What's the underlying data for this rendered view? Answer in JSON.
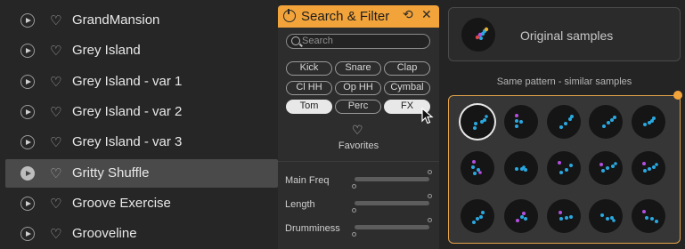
{
  "list": {
    "items": [
      {
        "name": "GrandMansion"
      },
      {
        "name": "Grey Island"
      },
      {
        "name": "Grey Island - var 1"
      },
      {
        "name": "Grey Island - var 2"
      },
      {
        "name": "Grey Island - var 3"
      },
      {
        "name": "Gritty Shuffle",
        "selected": true
      },
      {
        "name": "Groove Exercise"
      },
      {
        "name": "Grooveline"
      }
    ]
  },
  "panel": {
    "title": "Search & Filter",
    "search_placeholder": "Search",
    "tags": [
      "Kick",
      "Snare",
      "Clap",
      "Cl HH",
      "Op HH",
      "Cymbal",
      "Tom",
      "Perc",
      "FX"
    ],
    "active_tags": [
      "Tom",
      "FX"
    ],
    "favorites_label": "Favorites",
    "sliders": [
      {
        "label": "Main Freq"
      },
      {
        "label": "Length"
      },
      {
        "label": "Drumminess"
      }
    ],
    "accent": "#f2a33a"
  },
  "right": {
    "original_label": "Original samples",
    "pattern_label": "Same pattern - similar samples"
  },
  "colors": {
    "dot_blue": "#2aa8e0",
    "dot_purple": "#b44fe0",
    "dot_red": "#e04848",
    "dot_yellow": "#e8b030",
    "accent": "#f2a33a"
  }
}
